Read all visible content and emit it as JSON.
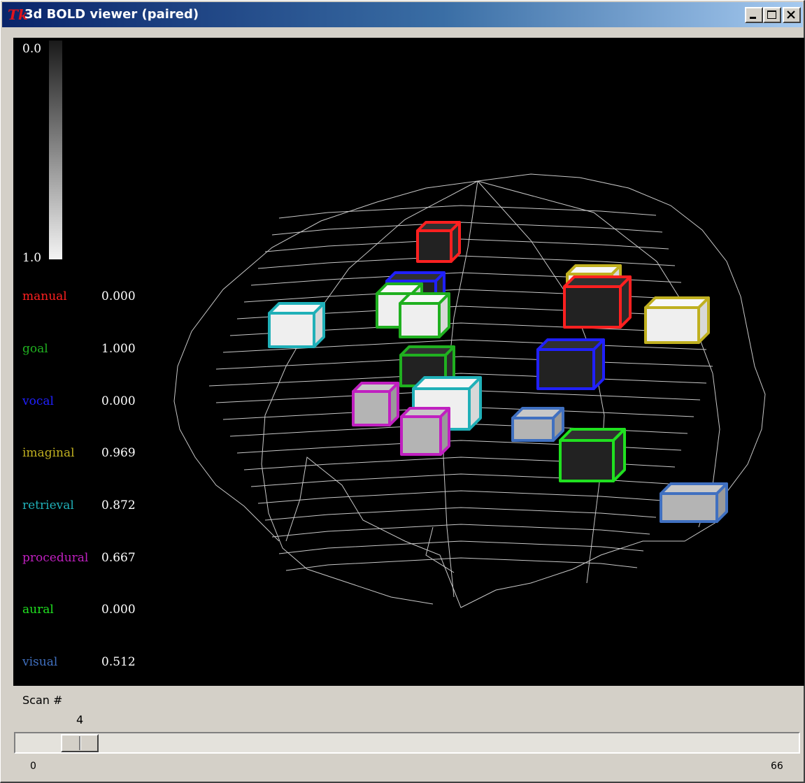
{
  "window": {
    "title": "3d BOLD viewer (paired)",
    "icon": "tk-feather-icon",
    "logo_text": "Tk",
    "controls": [
      "minimize-icon",
      "maximize-icon",
      "close-icon"
    ]
  },
  "scale": {
    "top_label": "0.0",
    "bottom_label": "1.0"
  },
  "modules": [
    {
      "name": "manual",
      "value": "0.000",
      "color": "#ff2020"
    },
    {
      "name": "goal",
      "value": "1.000",
      "color": "#20b020"
    },
    {
      "name": "vocal",
      "value": "0.000",
      "color": "#2020ff"
    },
    {
      "name": "imaginal",
      "value": "0.969",
      "color": "#c0b020"
    },
    {
      "name": "retrieval",
      "value": "0.872",
      "color": "#20b0b8"
    },
    {
      "name": "procedural",
      "value": "0.667",
      "color": "#c020c0"
    },
    {
      "name": "aural",
      "value": "0.000",
      "color": "#20e020"
    },
    {
      "name": "visual",
      "value": "0.512",
      "color": "#4070c0"
    }
  ],
  "scan": {
    "label": "Scan #",
    "value": "4",
    "min": "0",
    "max": "66",
    "fraction": 0.061
  }
}
